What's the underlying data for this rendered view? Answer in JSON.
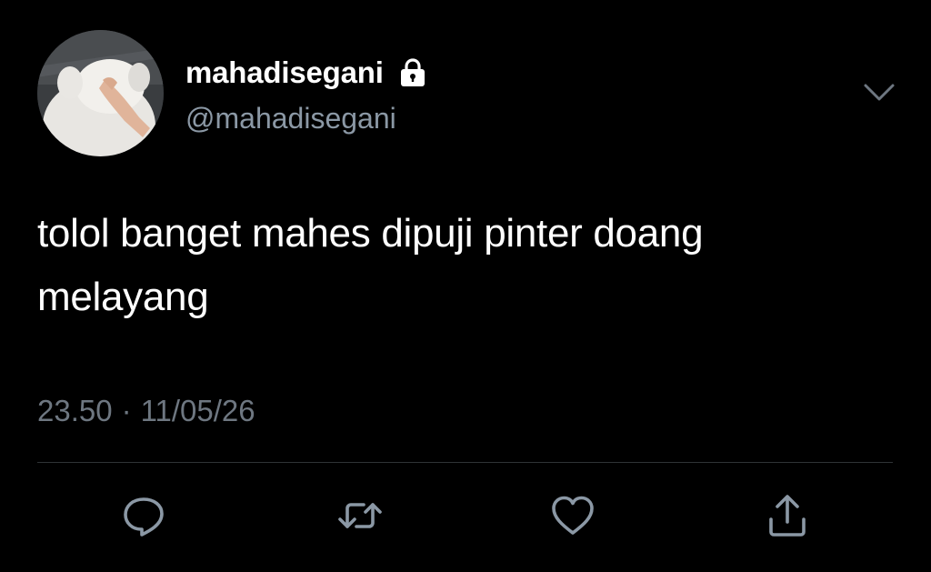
{
  "tweet": {
    "author": {
      "display_name": "mahadisegani",
      "handle": "@mahadisegani",
      "protected_icon": "lock-icon",
      "avatar": "avatar-image"
    },
    "text": "tolol banget mahes dipuji pinter doang\nmelayang",
    "time": "23.50",
    "separator": "·",
    "date": "11/05/26",
    "menu_icon": "chevron-down-icon"
  },
  "actions": [
    {
      "name": "reply",
      "icon": "reply-icon"
    },
    {
      "name": "retweet",
      "icon": "retweet-icon"
    },
    {
      "name": "like",
      "icon": "heart-icon"
    },
    {
      "name": "share",
      "icon": "share-icon"
    }
  ],
  "colors": {
    "background": "#000000",
    "primary_text": "#ffffff",
    "secondary_text": "#8b98a5",
    "meta_text": "#6e7781",
    "icon": "#8b98a5",
    "divider": "#2f3336"
  }
}
